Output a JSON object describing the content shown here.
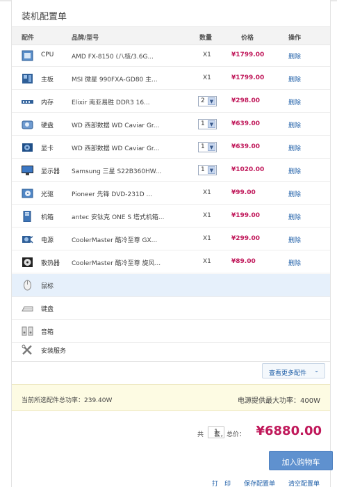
{
  "title": "装机配置单",
  "headers": {
    "part": "配件",
    "brand": "品牌/型号",
    "qty": "数量",
    "price": "价格",
    "op": "操作"
  },
  "rows": [
    {
      "cat": "CPU",
      "name": "AMD FX-8150 (八核/3.6G...",
      "qty": "X1",
      "price": "¥1799.00",
      "action": "删除",
      "icon": "cpu-icon"
    },
    {
      "cat": "主板",
      "name": "MSI 微星 990FXA-GD80 主...",
      "qty": "X1",
      "price": "¥1799.00",
      "action": "删除",
      "icon": "motherboard-icon"
    },
    {
      "cat": "内存",
      "name": "Elixir 南亚易胜 DDR3 16...",
      "qty": "2",
      "price": "¥298.00",
      "action": "删除",
      "icon": "memory-icon"
    },
    {
      "cat": "硬盘",
      "name": "WD 西部数据 WD Caviar Gr...",
      "qty": "1",
      "price": "¥639.00",
      "action": "删除",
      "icon": "harddisk-icon"
    },
    {
      "cat": "显卡",
      "name": "WD 西部数据 WD Caviar Gr...",
      "qty": "1",
      "price": "¥639.00",
      "action": "删除",
      "icon": "graphics-card-icon"
    },
    {
      "cat": "显示器",
      "name": "Samsung 三星 S22B360HW...",
      "qty": "1",
      "price": "¥1020.00",
      "action": "删除",
      "icon": "monitor-icon"
    },
    {
      "cat": "光驱",
      "name": "Pioneer 先锋 DVD-231D ...",
      "qty": "X1",
      "price": "¥99.00",
      "action": "删除",
      "icon": "optical-drive-icon"
    },
    {
      "cat": "机箱",
      "name": "antec 安钛克 ONE S 塔式机箱...",
      "qty": "X1",
      "price": "¥199.00",
      "action": "删除",
      "icon": "case-icon"
    },
    {
      "cat": "电源",
      "name": "CoolerMaster 酷冷至尊 GX...",
      "qty": "X1",
      "price": "¥299.00",
      "action": "删除",
      "icon": "power-supply-icon"
    },
    {
      "cat": "散热器",
      "name": "CoolerMaster 酷冷至尊 旋风...",
      "qty": "X1",
      "price": "¥89.00",
      "action": "删除",
      "icon": "cooler-icon"
    }
  ],
  "empty_rows": [
    {
      "cat": "鼠标",
      "icon": "mouse-icon"
    },
    {
      "cat": "键盘",
      "icon": "keyboard-icon"
    },
    {
      "cat": "音箱",
      "icon": "speaker-icon"
    },
    {
      "cat": "安装服务",
      "icon": "tools-icon"
    }
  ],
  "more_label": "查看更多配件",
  "power": {
    "current": "当前所选配件总功率：239.40W",
    "max": "电源提供最大功率：400W"
  },
  "summary": {
    "gong": "共",
    "sets": "1",
    "tao": "套，总价：",
    "total": "¥6880.00"
  },
  "add_cart": "加入购物车",
  "links": {
    "print": "打　印",
    "save": "保存配置单",
    "clear": "清空配置单"
  },
  "colors": {
    "price": "#c0185a",
    "link": "#1f5fa8",
    "button": "#5f91cf"
  }
}
